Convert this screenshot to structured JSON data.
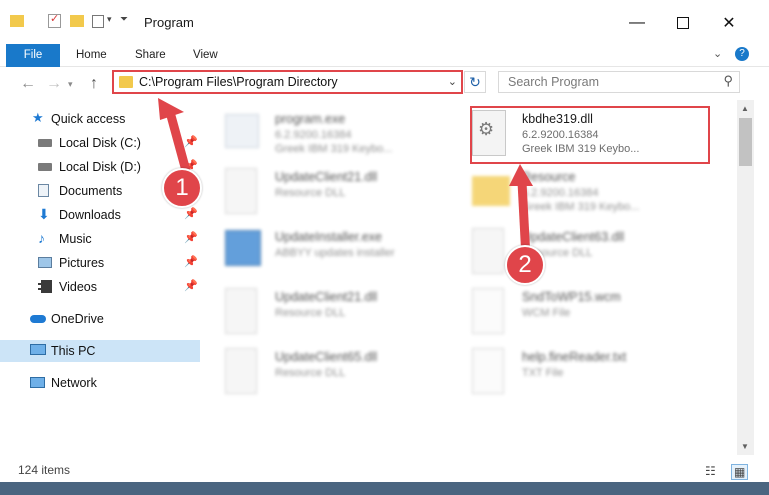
{
  "window": {
    "title": "Program",
    "controls": [
      "minimize-icon",
      "maximize-icon",
      "close-icon"
    ]
  },
  "ribbon": {
    "tabs": [
      {
        "label": "File"
      },
      {
        "label": "Home"
      },
      {
        "label": "Share"
      },
      {
        "label": "View"
      }
    ]
  },
  "address": {
    "path": "C:\\Program Files\\Program Directory"
  },
  "search": {
    "placeholder": "Search Program"
  },
  "sidebar": {
    "items": [
      {
        "label": "Quick access",
        "icon": "star-icon"
      },
      {
        "label": "Local Disk (C:)",
        "icon": "drive-icon",
        "pinned": true
      },
      {
        "label": "Local Disk (D:)",
        "icon": "drive-icon",
        "pinned": true
      },
      {
        "label": "Documents",
        "icon": "documents-icon",
        "pinned": true
      },
      {
        "label": "Downloads",
        "icon": "downloads-icon",
        "pinned": true
      },
      {
        "label": "Music",
        "icon": "music-icon",
        "pinned": true
      },
      {
        "label": "Pictures",
        "icon": "pictures-icon",
        "pinned": true
      },
      {
        "label": "Videos",
        "icon": "videos-icon",
        "pinned": true
      },
      {
        "label": "OneDrive",
        "icon": "onedrive-icon"
      },
      {
        "label": "This PC",
        "icon": "this-pc-icon",
        "selected": true
      },
      {
        "label": "Network",
        "icon": "network-icon"
      }
    ]
  },
  "files": [
    {
      "name": "program.exe",
      "meta1": "6.2.9200.16384",
      "meta2": "Greek IBM 319 Keybo..."
    },
    {
      "name": "kbdhe319.dll",
      "meta1": "6.2.9200.16384",
      "meta2": "Greek IBM 319 Keybo..."
    },
    {
      "name": "UpdateClient21.dll",
      "meta1": "Resource DLL",
      "meta2": ""
    },
    {
      "name": "Resource",
      "meta1": "6.2.9200.16384",
      "meta2": "Greek IBM 319 Keybo..."
    },
    {
      "name": "UpdateInstaller.exe",
      "meta1": "ABBYY updates installer",
      "meta2": ""
    },
    {
      "name": "UpdateClient63.dll",
      "meta1": "Resource DLL",
      "meta2": ""
    },
    {
      "name": "UpdateClient21.dll",
      "meta1": "Resource DLL",
      "meta2": ""
    },
    {
      "name": "SndToWP15.wcm",
      "meta1": "WCM File",
      "meta2": ""
    },
    {
      "name": "UpdateClient65.dll",
      "meta1": "Resource DLL",
      "meta2": ""
    },
    {
      "name": "help.fineReader.txt",
      "meta1": "TXT File",
      "meta2": ""
    }
  ],
  "status": {
    "items_count": "124 items"
  },
  "callouts": [
    "1",
    "2"
  ],
  "colors": {
    "accent": "#1979ca",
    "highlight": "#e0454a",
    "selected": "#cce4f7"
  }
}
